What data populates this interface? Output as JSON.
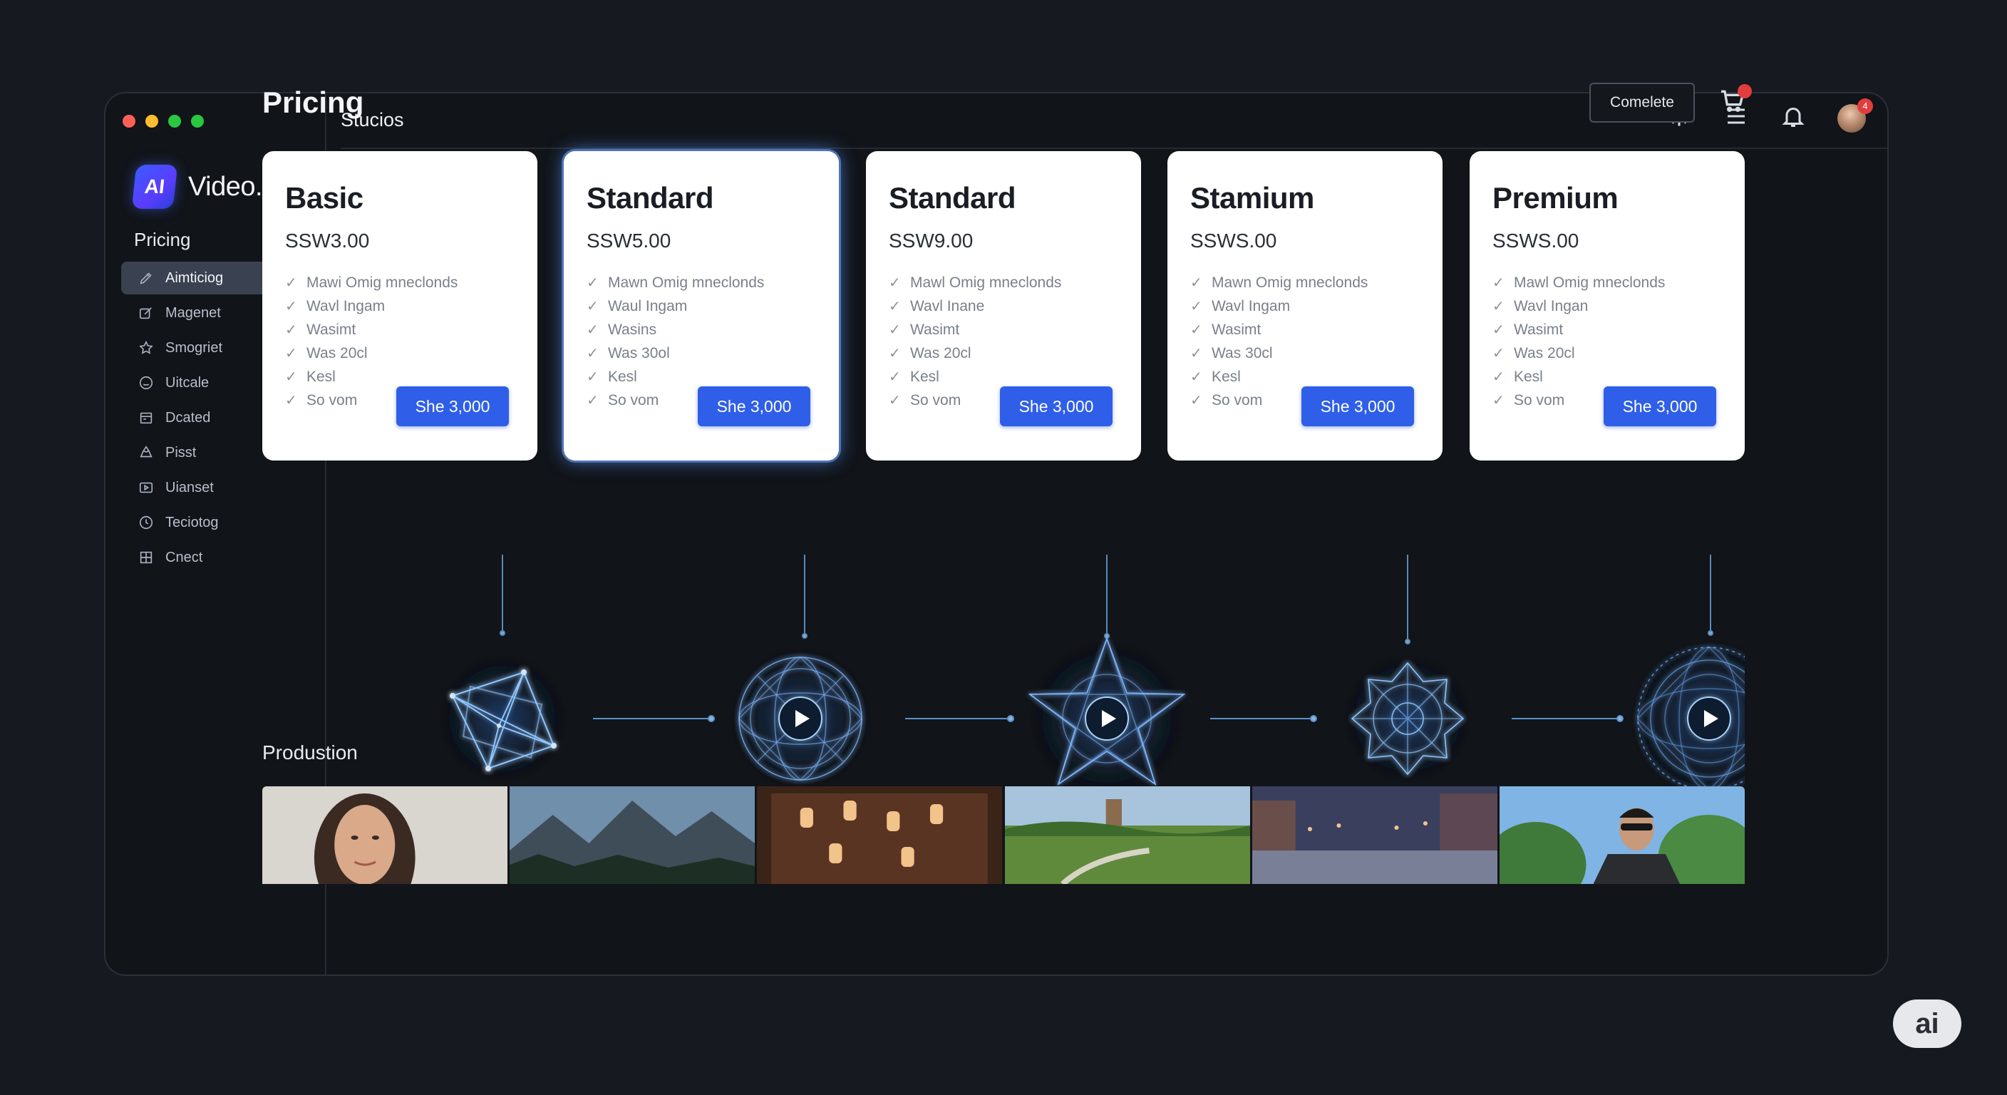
{
  "window": {
    "traffic_lights": [
      "#ff5f57",
      "#febc2e",
      "#28c840",
      "#28c840"
    ]
  },
  "brand": {
    "logo_text": "AI",
    "name": "Video.io"
  },
  "sidebar": {
    "section_label": "Pricing",
    "items": [
      {
        "label": "Aimticiog",
        "icon": "edit-icon",
        "active": true
      },
      {
        "label": "Magenet",
        "icon": "pencil-icon",
        "active": false
      },
      {
        "label": "Smogriet",
        "icon": "star-icon",
        "active": false
      },
      {
        "label": "Uitcale",
        "icon": "smile-icon",
        "active": false
      },
      {
        "label": "Dcated",
        "icon": "calendar-icon",
        "active": false
      },
      {
        "label": "Pisst",
        "icon": "share-icon",
        "active": false
      },
      {
        "label": "Uianset",
        "icon": "video-icon",
        "active": false
      },
      {
        "label": "Teciotog",
        "icon": "clock-icon",
        "active": false
      },
      {
        "label": "Cnect",
        "icon": "grid-icon",
        "active": false
      }
    ]
  },
  "topbar": {
    "title": "Stucios",
    "icons": [
      "settings-icon",
      "menu-icon",
      "bell-icon"
    ],
    "avatar_badge": "4"
  },
  "main": {
    "page_title": "Pricing",
    "complete_label": "Comelete",
    "cart_icon": "cart-icon"
  },
  "plans": [
    {
      "title": "Basic",
      "price": "SSW3.00",
      "features": [
        "Mawi Omig mneclonds",
        "Wavl Ingam",
        "Wasimt",
        "Was 20cl",
        "Kesl",
        "So vom"
      ],
      "button": "She 3,000",
      "highlight": false
    },
    {
      "title": "Standard",
      "price": "SSW5.00",
      "features": [
        "Mawn Omig mneclonds",
        "Waul Ingam",
        "Wasins",
        "Was 30ol",
        "Kesl",
        "So vom"
      ],
      "button": "She 3,000",
      "highlight": true
    },
    {
      "title": "Standard",
      "price": "SSW9.00",
      "features": [
        "Mawl Omig mneclonds",
        "Wavl Inane",
        "Wasimt",
        "Was 20cl",
        "Kesl",
        "So vom"
      ],
      "button": "She 3,000",
      "highlight": false
    },
    {
      "title": "Stamium",
      "price": "SSWS.00",
      "features": [
        "Mawn Omig mneclonds",
        "Wavl Ingam",
        "Wasimt",
        "Was 30cl",
        "Kesl",
        "So vom"
      ],
      "button": "She 3,000",
      "highlight": false
    },
    {
      "title": "Premium",
      "price": "SSWS.00",
      "features": [
        "Mawl Omig mneclonds",
        "Wavl Ingan",
        "Wasimt",
        "Was 20cl",
        "Kesl",
        "So vom"
      ],
      "button": "She 3,000",
      "highlight": false
    }
  ],
  "network_nodes": [
    {
      "shape": "crystal",
      "has_play": false
    },
    {
      "shape": "sphere",
      "has_play": true
    },
    {
      "shape": "star",
      "has_play": true
    },
    {
      "shape": "mandala",
      "has_play": false
    },
    {
      "shape": "sphere",
      "has_play": true
    }
  ],
  "production": {
    "title": "Produstion",
    "thumbnails": [
      "portrait-woman",
      "mountains",
      "lantern-street",
      "park-landscape",
      "city-plaza",
      "man-sunglasses"
    ]
  },
  "corner_badge": "ai",
  "colors": {
    "accent": "#2f5fe8",
    "glow": "#7fb8ff",
    "background": "#111419"
  }
}
